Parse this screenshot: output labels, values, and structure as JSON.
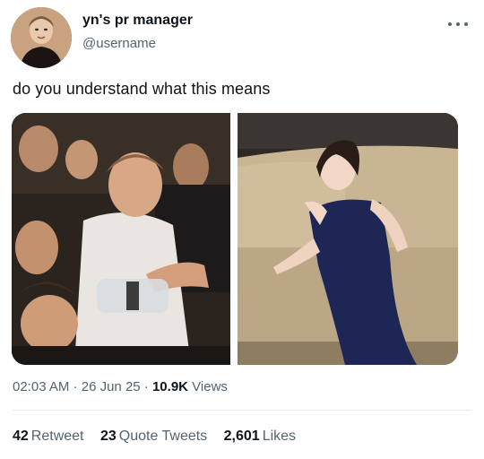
{
  "author": {
    "display_name": "yn's pr manager",
    "handle": "@username"
  },
  "tweet": {
    "text": "do you understand what this means"
  },
  "media": [
    {
      "name": "left-photo"
    },
    {
      "name": "right-photo"
    }
  ],
  "meta": {
    "time": "02:03 AM",
    "sep1": "·",
    "date": "26 Jun 25",
    "sep2": "·",
    "views_count": "10.9K",
    "views_label": "Views"
  },
  "stats": {
    "retweets_count": "42",
    "retweets_label": "Retweet",
    "quotes_count": "23",
    "quotes_label": "Quote Tweets",
    "likes_count": "2,601",
    "likes_label": "Likes"
  },
  "icons": {
    "more": "more-horizontal-icon"
  },
  "colors": {
    "text_primary": "#0f1419",
    "text_secondary": "#536471",
    "divider": "#e6ecf0"
  }
}
